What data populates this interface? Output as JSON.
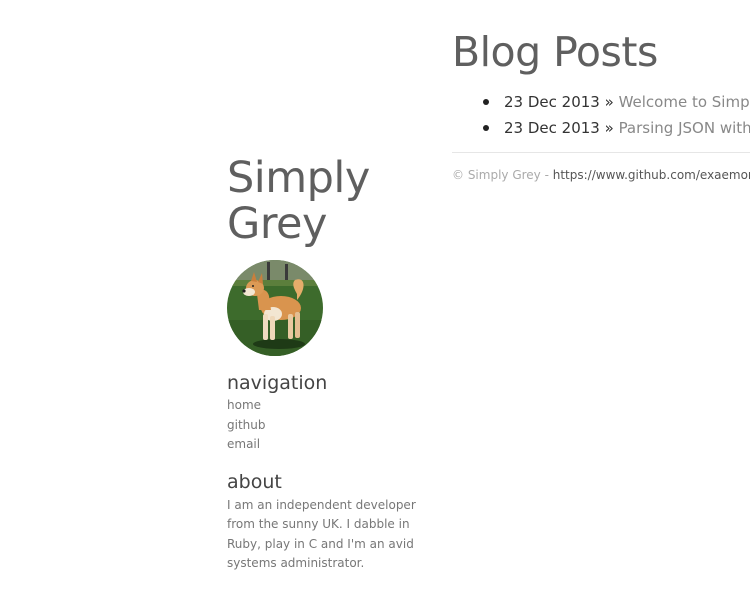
{
  "site": {
    "title_line1": "Simply",
    "title_line2": "Grey"
  },
  "sidebar": {
    "avatar_icon": "dog-photo",
    "navigation_heading": "navigation",
    "nav_items": [
      {
        "label": "home"
      },
      {
        "label": "github"
      },
      {
        "label": "email"
      }
    ],
    "about_heading": "about",
    "about_text": "I am an independent developer from the sunny UK. I dabble in Ruby, play in C and I'm an avid systems administrator."
  },
  "main": {
    "page_title": "Blog Posts",
    "posts": [
      {
        "date": "23 Dec 2013",
        "separator": "»",
        "title": "Welcome to Simply Grey"
      },
      {
        "date": "23 Dec 2013",
        "separator": "»",
        "title": "Parsing JSON with Ruby"
      }
    ]
  },
  "footer": {
    "copyright": "© Simply Grey",
    "separator": " - ",
    "link": "https://www.github.com/exaemon/simplygrey"
  },
  "colors": {
    "heading": "#5f5f5f",
    "muted_text": "#777777",
    "link_grey": "#888888",
    "divider": "#e6e6e6"
  }
}
